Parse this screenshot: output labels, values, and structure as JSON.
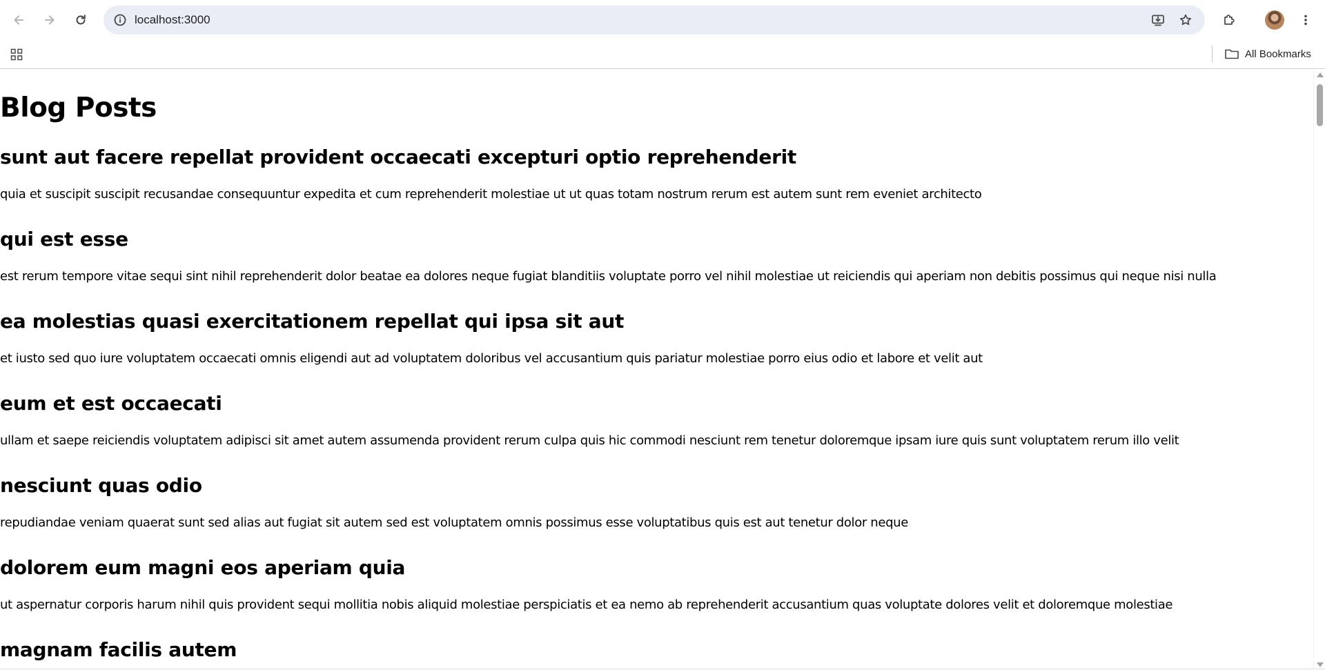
{
  "browser": {
    "url": "localhost:3000",
    "bookmarks_label": "All Bookmarks",
    "icons": [
      "back-icon",
      "forward-icon",
      "reload-icon",
      "site-info-icon",
      "install-app-icon",
      "bookmark-star-icon",
      "extensions-icon",
      "avatar",
      "more-menu-icon",
      "apps-grid-icon",
      "folder-icon"
    ]
  },
  "page": {
    "title": "Blog Posts",
    "posts": [
      {
        "title": "sunt aut facere repellat provident occaecati excepturi optio reprehenderit",
        "body": "quia et suscipit suscipit recusandae consequuntur expedita et cum reprehenderit molestiae ut ut quas totam nostrum rerum est autem sunt rem eveniet architecto"
      },
      {
        "title": "qui est esse",
        "body": "est rerum tempore vitae sequi sint nihil reprehenderit dolor beatae ea dolores neque fugiat blanditiis voluptate porro vel nihil molestiae ut reiciendis qui aperiam non debitis possimus qui neque nisi nulla"
      },
      {
        "title": "ea molestias quasi exercitationem repellat qui ipsa sit aut",
        "body": "et iusto sed quo iure voluptatem occaecati omnis eligendi aut ad voluptatem doloribus vel accusantium quis pariatur molestiae porro eius odio et labore et velit aut"
      },
      {
        "title": "eum et est occaecati",
        "body": "ullam et saepe reiciendis voluptatem adipisci sit amet autem assumenda provident rerum culpa quis hic commodi nesciunt rem tenetur doloremque ipsam iure quis sunt voluptatem rerum illo velit"
      },
      {
        "title": "nesciunt quas odio",
        "body": "repudiandae veniam quaerat sunt sed alias aut fugiat sit autem sed est voluptatem omnis possimus esse voluptatibus quis est aut tenetur dolor neque"
      },
      {
        "title": "dolorem eum magni eos aperiam quia",
        "body": "ut aspernatur corporis harum nihil quis provident sequi mollitia nobis aliquid molestiae perspiciatis et ea nemo ab reprehenderit accusantium quas voluptate dolores velit et doloremque molestiae"
      },
      {
        "title": "magnam facilis autem",
        "body": ""
      }
    ]
  }
}
